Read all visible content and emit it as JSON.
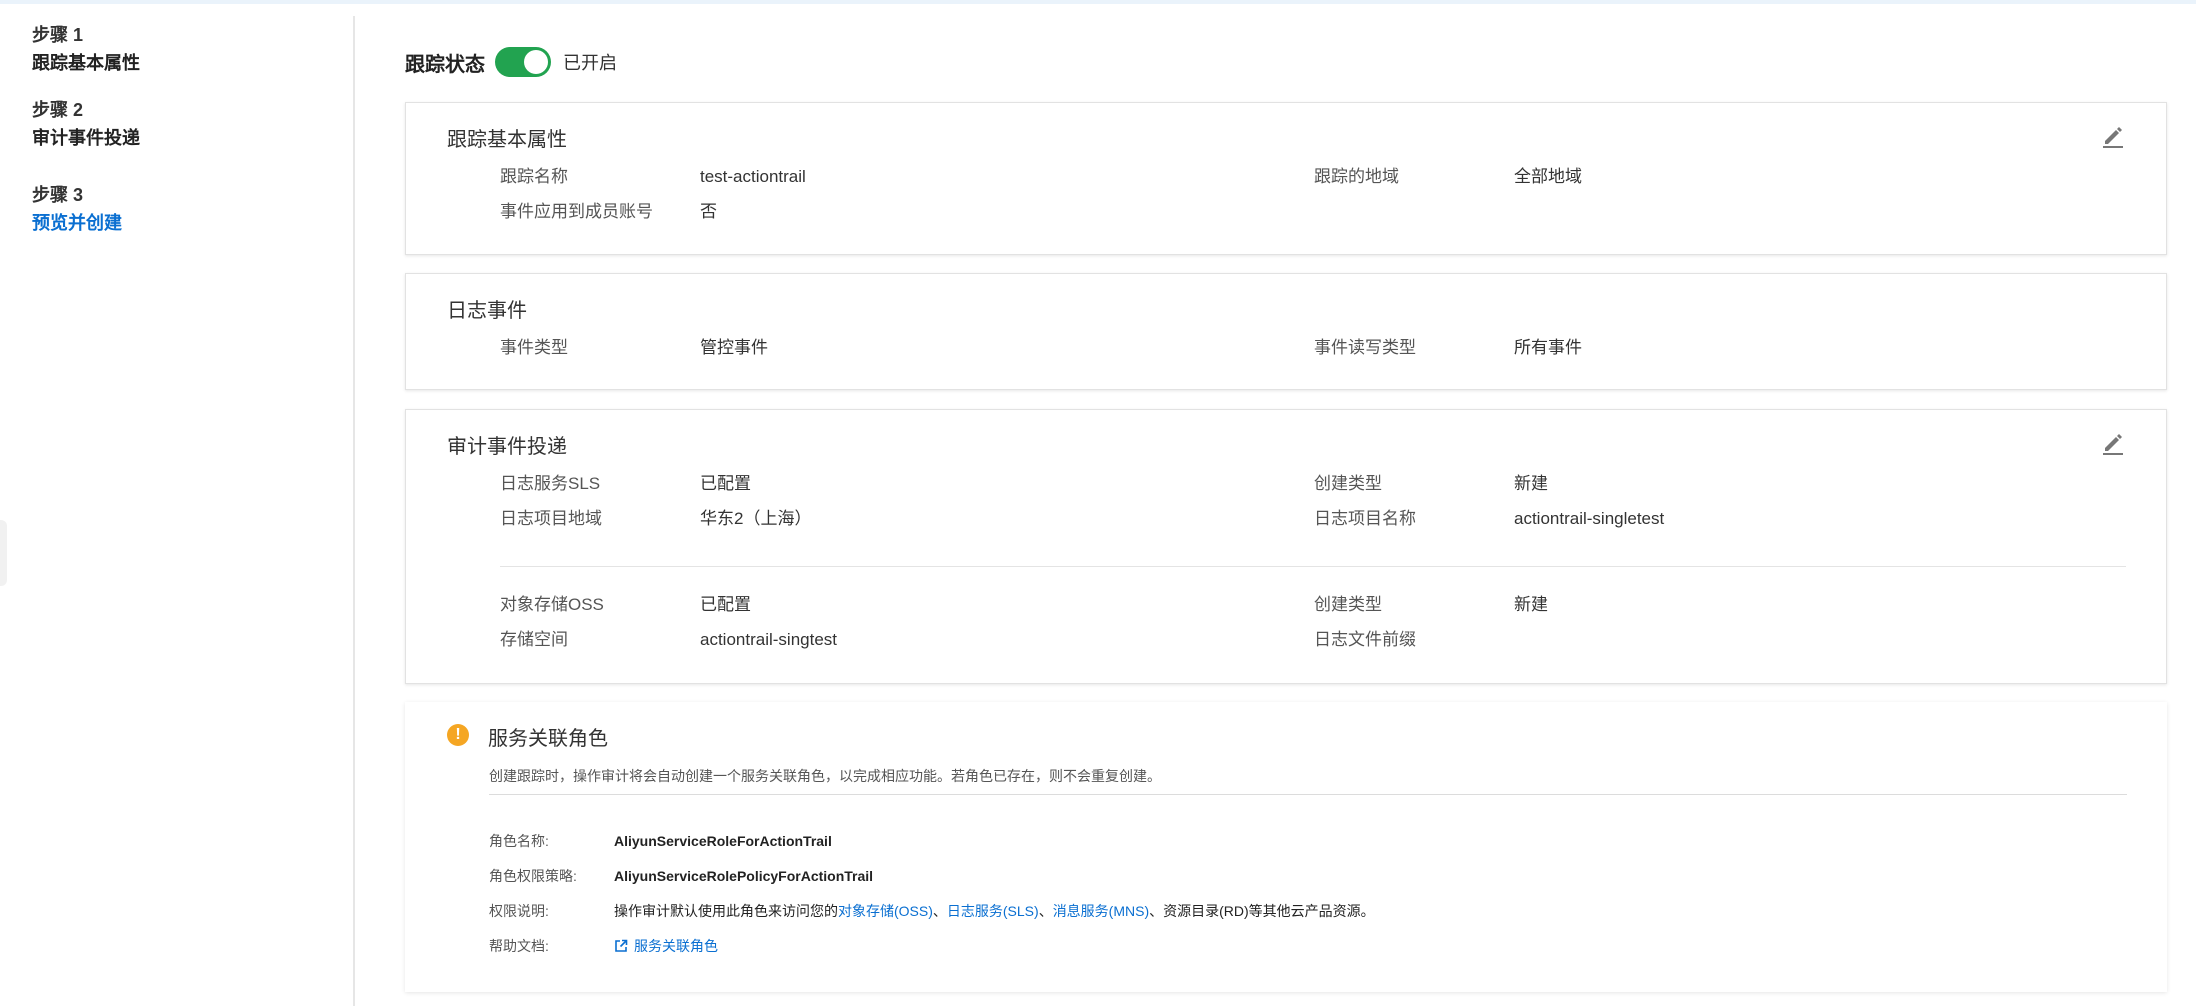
{
  "steps": [
    {
      "num": "步骤 1",
      "title": "跟踪基本属性",
      "active": false
    },
    {
      "num": "步骤 2",
      "title": "审计事件投递",
      "active": false
    },
    {
      "num": "步骤 3",
      "title": "预览并创建",
      "active": true
    }
  ],
  "tracking": {
    "label": "跟踪状态",
    "state_text": "已开启",
    "enabled": true,
    "toggle_color": "#22a350"
  },
  "basic": {
    "title": "跟踪基本属性",
    "name_label": "跟踪名称",
    "name_value": "test-actiontrail",
    "region_label": "跟踪的地域",
    "region_value": "全部地域",
    "apply_label": "事件应用到成员账号",
    "apply_value": "否"
  },
  "log_events": {
    "title": "日志事件",
    "type_label": "事件类型",
    "type_value": "管控事件",
    "rw_label": "事件读写类型",
    "rw_value": "所有事件"
  },
  "delivery": {
    "title": "审计事件投递",
    "sls": {
      "label": "日志服务SLS",
      "value": "已配置",
      "create_type_label": "创建类型",
      "create_type_value": "新建",
      "region_label": "日志项目地域",
      "region_value": "华东2（上海）",
      "project_label": "日志项目名称",
      "project_value": "actiontrail-singletest"
    },
    "oss": {
      "label": "对象存储OSS",
      "value": "已配置",
      "create_type_label": "创建类型",
      "create_type_value": "新建",
      "bucket_label": "存储空间",
      "bucket_value": "actiontrail-singtest",
      "prefix_label": "日志文件前缀",
      "prefix_value": ""
    }
  },
  "service_role": {
    "title": "服务关联角色",
    "desc": "创建跟踪时，操作审计将会自动创建一个服务关联角色，以完成相应功能。若角色已存在，则不会重复创建。",
    "role_name_label": "角色名称:",
    "role_name": "AliyunServiceRoleForActionTrail",
    "policy_label": "角色权限策略:",
    "policy": "AliyunServiceRolePolicyForActionTrail",
    "perm_label": "权限说明:",
    "perm_prefix": "操作审计默认使用此角色来访问您的",
    "perm_link_oss": "对象存储(OSS)",
    "perm_sep1": "、",
    "perm_link_sls": "日志服务(SLS)",
    "perm_sep2": "、",
    "perm_link_mns": "消息服务(MNS)",
    "perm_suffix": "、资源目录(RD)等其他云产品资源。",
    "help_label": "帮助文档:",
    "help_link": "服务关联角色",
    "warn_color": "#f5a623",
    "link_color": "#0a6fd1"
  }
}
